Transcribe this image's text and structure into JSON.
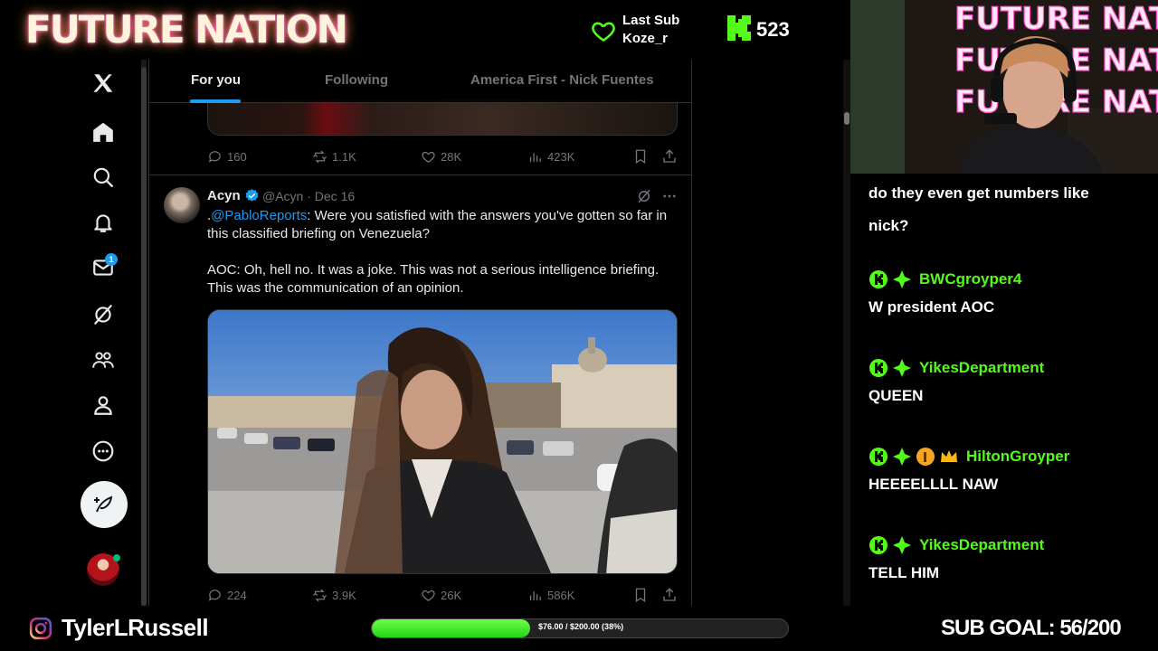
{
  "overlay": {
    "stream_title": "FUTURE NATION",
    "last_sub_label": "Last Sub",
    "last_sub_name": "Koze_r",
    "viewer_count": "523",
    "instagram_handle": "TylerLRussell",
    "goal_progress_text": "$76.00 / $200.00 (38%)",
    "goal_progress_fraction": 0.38,
    "sub_goal": "SUB GOAL: 56/200",
    "accent_green": "#53fc18"
  },
  "x": {
    "tabs": [
      {
        "label": "For you",
        "active": true
      },
      {
        "label": "Following",
        "active": false
      },
      {
        "label": "America First - Nick Fuentes",
        "active": false
      }
    ],
    "notification_badge": "1",
    "previous_post": {
      "replies": "160",
      "reposts": "1.1K",
      "likes": "28K",
      "views": "423K"
    },
    "post": {
      "author": "Acyn",
      "handle_date": "@Acyn · Dec 16",
      "text_prefix": ".",
      "mention": "@PabloReports",
      "text": ": Were you satisfied with the answers you've gotten so far in this classified briefing on Venezuela?\n\nAOC: Oh, hell no. It was a joke. This was not a serious intelligence briefing. This was the communication of an opinion.",
      "replies": "224",
      "reposts": "3.9K",
      "likes": "26K",
      "views": "586K"
    },
    "accent_blue": "#1d9bf0"
  },
  "chat": {
    "messages": [
      {
        "user": "",
        "text": "do they even get numbers like"
      },
      {
        "user": "",
        "text": "nick?"
      },
      {
        "user": "BWCgroyper4",
        "text": "W president AOC",
        "badges": [
          "kick",
          "diamond"
        ]
      },
      {
        "user": "YikesDepartment",
        "text": "QUEEN",
        "badges": [
          "kick",
          "diamond"
        ]
      },
      {
        "user": "HiltonGroyper",
        "text": "HEEEELLLL NAW",
        "badges": [
          "kick",
          "diamond",
          "one",
          "crown"
        ]
      },
      {
        "user": "YikesDepartment",
        "text": "TELL HIM",
        "badges": [
          "kick",
          "diamond"
        ]
      }
    ]
  }
}
